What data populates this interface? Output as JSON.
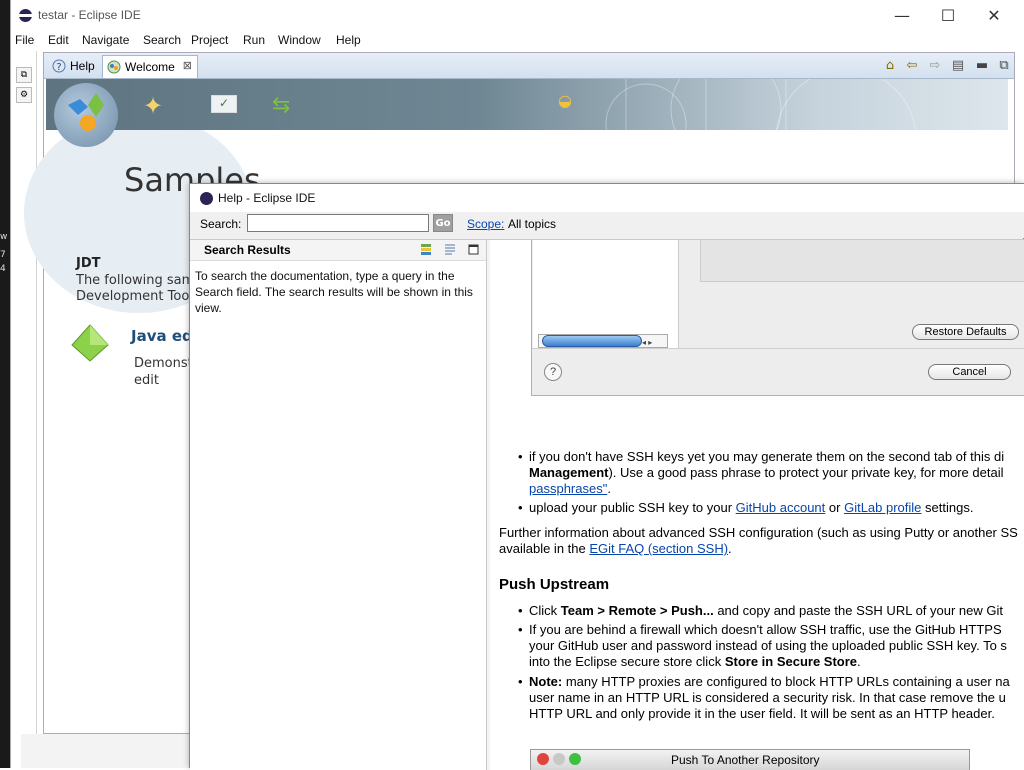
{
  "app": {
    "title": "testar - Eclipse IDE",
    "window_controls": {
      "minimize": "—",
      "maximize": "☐",
      "close": "✕"
    }
  },
  "desktop_strip": {
    "chars": [
      "w",
      "7",
      "4"
    ]
  },
  "menu": {
    "items": [
      "File",
      "Edit",
      "Navigate",
      "Search",
      "Project",
      "Run",
      "Window",
      "Help"
    ]
  },
  "tabs": [
    {
      "label": "Help",
      "icon": "help-icon",
      "active": false
    },
    {
      "label": "Welcome",
      "icon": "welcome-icon",
      "active": true,
      "close": "⊠"
    }
  ],
  "welcome": {
    "page_title": "Samples",
    "section_heading": "JDT",
    "section_desc": "The following sam Development Too",
    "sample_title": "Java ed",
    "sample_desc": "Demonst text edit"
  },
  "help_dialog": {
    "title": "Help - Eclipse IDE",
    "search_label": "Search:",
    "search_value": "",
    "go_label": "Go",
    "scope_link": "Scope:",
    "scope_value": "All topics",
    "results": {
      "title": "Search Results",
      "text": "To search the documentation, type a query in the Search field. The search results will be shown in this view."
    },
    "content": {
      "screenshot1": {
        "restore_defaults": "Restore Defaults",
        "cancel": "Cancel",
        "help_glyph": "?",
        "scroll_arrows": "◂ ▸"
      },
      "bullet1": {
        "pre": "if you don't have SSH keys yet you may generate them on the second tab of this di",
        "bold": "Management",
        "mid": "). Use a good pass phrase to protect your private key, for more detail",
        "link": "passphrases\"",
        "post": "."
      },
      "bullet2": {
        "pre": "upload your public SSH key to your ",
        "link1": "GitHub account",
        "mid": " or ",
        "link2": "GitLab profile",
        "post": " settings."
      },
      "further": {
        "pre": "Further information about advanced SSH configuration (such as using Putty or another SS available in the ",
        "link": "EGit FAQ (section SSH)",
        "post": "."
      },
      "heading_push": "Push Upstream",
      "bullet3": {
        "pre": "Click ",
        "bold": "Team > Remote > Push...",
        "post": " and copy and paste the SSH URL of your new Git"
      },
      "bullet4": {
        "pre": "If you are behind a firewall which doesn't allow SSH traffic, use the GitHub HTTPS your GitHub user and password instead of using the uploaded public SSH key. To s into the Eclipse secure store click ",
        "bold": "Store in Secure Store",
        "post": "."
      },
      "bullet5": {
        "bold": "Note:",
        "post": " many HTTP proxies are configured to block HTTP URLs containing a user na user name in an HTTP URL is considered a security risk. In that case remove the u HTTP URL and only provide it in the user field. It will be sent as an HTTP header."
      },
      "screenshot2_title": "Push To Another Repository"
    }
  },
  "colors": {
    "link": "#0645ad",
    "banner": "#5e7480",
    "sample_title": "#1f4e79"
  }
}
